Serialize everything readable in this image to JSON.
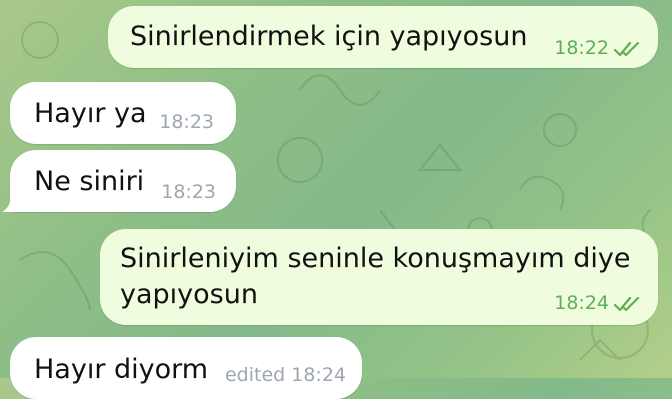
{
  "messages": [
    {
      "direction": "outgoing",
      "text": "Sinirlendirmek için yapıyosun",
      "time": "18:22",
      "status": "read-check-icon"
    },
    {
      "direction": "incoming",
      "text": "Hayır ya",
      "time": "18:23"
    },
    {
      "direction": "incoming",
      "text": "Ne siniri",
      "time": "18:23"
    },
    {
      "direction": "outgoing",
      "text_line1": "Sinirleniyim seninle konuşmayım diye",
      "text_line2": "yapıyosun",
      "time": "18:24",
      "status": "read-check-icon"
    },
    {
      "direction": "incoming",
      "text": "Hayır diyorm",
      "time": "edited 18:24"
    }
  ],
  "colors": {
    "outgoing_bubble": "#effdde",
    "incoming_bubble": "#ffffff",
    "outgoing_meta": "#5fae57",
    "incoming_meta": "#9ea7b0"
  }
}
